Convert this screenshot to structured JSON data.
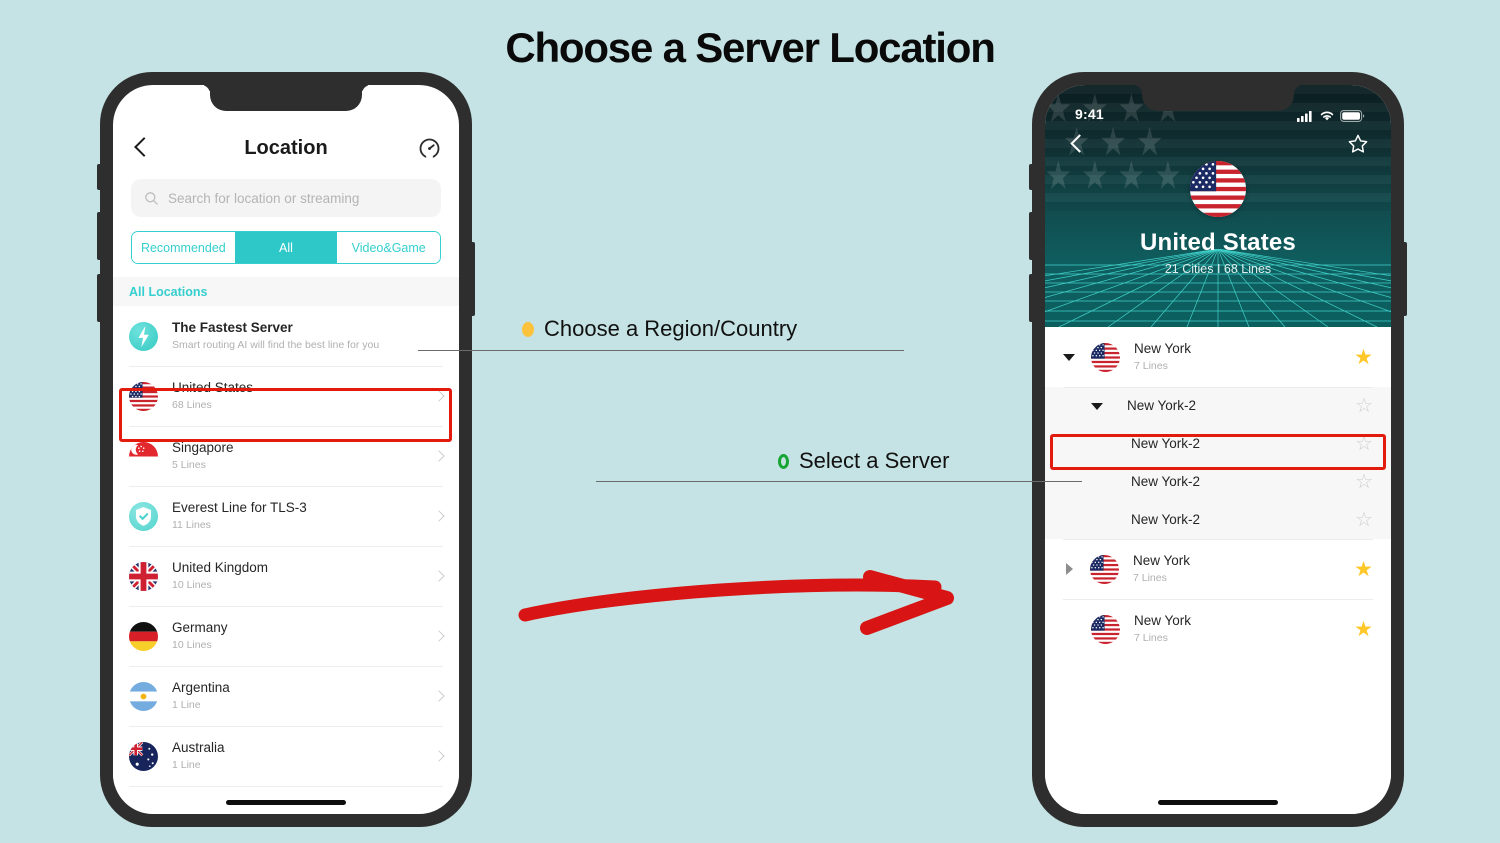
{
  "page": {
    "title": "Choose a Server Location",
    "background_color": "#c5e3e4",
    "accent_teal": "#2ec8c8",
    "highlight_red": "#e31b0c",
    "star_gold": "#ffc727"
  },
  "annotations": [
    {
      "id": "step-1",
      "bullet": "yellow-oval-bullet",
      "bullet_color": "#fcc23c",
      "text": "Choose a Region/Country"
    },
    {
      "id": "step-2",
      "bullet": "green-oval-bullet",
      "bullet_color": "#16a532",
      "text": "Select a Server"
    }
  ],
  "arrow": {
    "name": "red-curved-arrow",
    "color": "#d81414"
  },
  "left_phone": {
    "header": {
      "back_icon": "chevron-left-icon",
      "title": "Location",
      "action_icon": "speedometer-icon"
    },
    "search": {
      "icon": "search-icon",
      "placeholder": "Search for location or streaming",
      "value": ""
    },
    "tabs": [
      {
        "label": "Recommended",
        "active": false
      },
      {
        "label": "All",
        "active": true
      },
      {
        "label": "Video&Game",
        "active": false
      }
    ],
    "section_header": "All Locations",
    "rows": [
      {
        "icon": "fastest-server-bolt-icon",
        "title": "The Fastest Server",
        "sub": "Smart routing AI will find the best line for you",
        "chevron": false,
        "highlighted": false
      },
      {
        "icon": "flag-us",
        "title": "United States",
        "sub": "68 Lines",
        "chevron": true,
        "highlighted": true
      },
      {
        "icon": "flag-sg",
        "title": "Singapore",
        "sub": "5 Lines",
        "chevron": true,
        "highlighted": false
      },
      {
        "icon": "shield-check-icon",
        "title": "Everest Line for TLS-3",
        "sub": "11 Lines",
        "chevron": true,
        "highlighted": false
      },
      {
        "icon": "flag-gb",
        "title": "United Kingdom",
        "sub": "10 Lines",
        "chevron": true,
        "highlighted": false
      },
      {
        "icon": "flag-de",
        "title": "Germany",
        "sub": "10 Lines",
        "chevron": true,
        "highlighted": false
      },
      {
        "icon": "flag-ar",
        "title": "Argentina",
        "sub": "1 Line",
        "chevron": true,
        "highlighted": false
      },
      {
        "icon": "flag-au",
        "title": "Australia",
        "sub": "1 Line",
        "chevron": true,
        "highlighted": false
      }
    ]
  },
  "right_phone": {
    "status_bar": {
      "time": "9:41",
      "icons": [
        "cellular-signal-icon",
        "wifi-icon",
        "battery-icon"
      ]
    },
    "hero": {
      "back_icon": "chevron-left-icon",
      "favorite_icon": "star-outline-icon",
      "flag": "flag-us",
      "title": "United States",
      "subtitle": "21 Cities I 68 Lines"
    },
    "rows": [
      {
        "level": "city",
        "toggle": "triangle-down",
        "flag": "flag-us",
        "title": "New York",
        "sub": "7 Lines",
        "star": "filled",
        "highlighted": false
      },
      {
        "level": "server",
        "toggle": "triangle-down",
        "flag": "",
        "title": "New York-2",
        "sub": "",
        "star": "outline",
        "highlighted": false
      },
      {
        "level": "server2",
        "toggle": "",
        "flag": "",
        "title": "New York-2",
        "sub": "",
        "star": "outline",
        "highlighted": true
      },
      {
        "level": "server2",
        "toggle": "",
        "flag": "",
        "title": "New York-2",
        "sub": "",
        "star": "outline",
        "highlighted": false
      },
      {
        "level": "server2",
        "toggle": "",
        "flag": "",
        "title": "New York-2",
        "sub": "",
        "star": "outline",
        "highlighted": false
      },
      {
        "level": "city",
        "toggle": "triangle-right",
        "flag": "flag-us",
        "title": "New York",
        "sub": "7 Lines",
        "star": "filled",
        "highlighted": false
      },
      {
        "level": "city",
        "toggle": "",
        "flag": "flag-us",
        "title": "New York",
        "sub": "7 Lines",
        "star": "filled",
        "highlighted": false
      }
    ]
  }
}
